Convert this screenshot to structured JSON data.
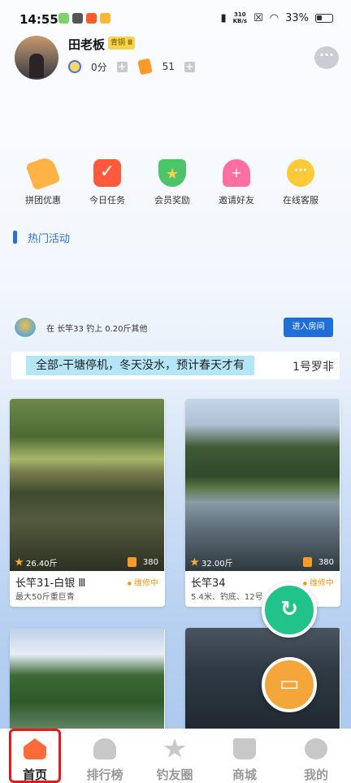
{
  "status_bar": {
    "time": "14:55",
    "net_speed_value": "310",
    "net_speed_unit": "KB/s",
    "battery": "33%"
  },
  "user": {
    "name": "田老板",
    "level_badge": "青铜 Ⅲ",
    "points": "0分",
    "tickets": "51"
  },
  "quick_menu": [
    {
      "label": "拼团优惠",
      "icon": "price-tag-icon"
    },
    {
      "label": "今日任务",
      "icon": "checkmark-task-icon"
    },
    {
      "label": "会员奖励",
      "icon": "medal-icon"
    },
    {
      "label": "邀请好友",
      "icon": "invite-person-icon"
    },
    {
      "label": "在线客服",
      "icon": "chat-bubble-icon"
    }
  ],
  "hot_section": {
    "title": "热门活动"
  },
  "activity": {
    "text": "在 长竿33 钓上 0.20斤其他",
    "button": "进入房间"
  },
  "notice": {
    "main": "全部-干塘停机，冬天没水，预计春天才有",
    "next": "1号罗非"
  },
  "cards": [
    {
      "weight": "26.40斤",
      "price": "380",
      "name": "长竿31-白银 Ⅲ",
      "status": "维修中",
      "desc": "最大50斤重巨青"
    },
    {
      "weight": "32.00斤",
      "price": "380",
      "name": "长竿34",
      "status": "维修中",
      "desc": "5.4米、钓底、12号"
    },
    {
      "weight": "",
      "price": "",
      "name": "",
      "status": "",
      "desc": ""
    },
    {
      "weight": "",
      "price": "",
      "name": "",
      "status": "",
      "desc": ""
    }
  ],
  "fab": {
    "refresh_icon": "refresh-icon",
    "sofa_icon": "sofa-icon"
  },
  "tabs": [
    {
      "label": "首页",
      "icon": "home-icon",
      "active": true
    },
    {
      "label": "排行榜",
      "icon": "ranking-icon",
      "active": false
    },
    {
      "label": "钓友圈",
      "icon": "star-circle-icon",
      "active": false
    },
    {
      "label": "商城",
      "icon": "basket-icon",
      "active": false
    },
    {
      "label": "我的",
      "icon": "profile-icon",
      "active": false
    }
  ],
  "colors": {
    "accent": "#2b6fdc",
    "status_orange": "#f09a1a",
    "fab_green": "#22c38a",
    "fab_orange": "#f5a63a",
    "active_tab_frame": "#e21a1a"
  }
}
